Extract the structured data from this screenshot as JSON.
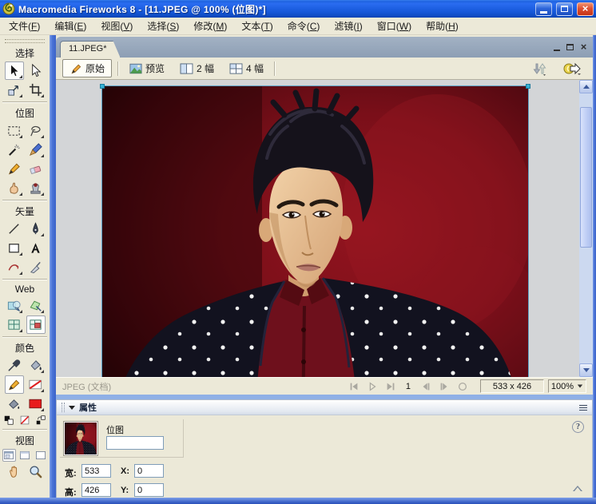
{
  "window": {
    "title": "Macromedia Fireworks 8 - [11.JPEG @ 100% (位图)*]"
  },
  "menu": {
    "items": [
      {
        "label": "文件",
        "letter": "F"
      },
      {
        "label": "编辑",
        "letter": "E"
      },
      {
        "label": "视图",
        "letter": "V"
      },
      {
        "label": "选择",
        "letter": "S"
      },
      {
        "label": "修改",
        "letter": "M"
      },
      {
        "label": "文本",
        "letter": "T"
      },
      {
        "label": "命令",
        "letter": "C"
      },
      {
        "label": "滤镜",
        "letter": "I"
      },
      {
        "label": "窗口",
        "letter": "W"
      },
      {
        "label": "帮助",
        "letter": "H"
      }
    ]
  },
  "document": {
    "tab_label": "11.JPEG*",
    "toolbar": {
      "original_label": "原始",
      "preview_label": "预览",
      "two_up_label": "2 幅",
      "four_up_label": "4 幅"
    },
    "status": {
      "doc_type": "JPEG (文档)",
      "frame_number": "1",
      "canvas_size": "533 x 426",
      "zoom_level": "100%"
    }
  },
  "tools": {
    "sections": [
      {
        "label": "选择",
        "rows": [
          [
            {
              "icon": "pointer",
              "name": "pointer-tool",
              "selected": true,
              "arrow": true
            },
            {
              "icon": "subselect",
              "name": "subselection-tool"
            }
          ],
          [
            {
              "icon": "scale",
              "name": "scale-tool",
              "arrow": true
            },
            {
              "icon": "crop",
              "name": "crop-tool",
              "arrow": true
            }
          ]
        ]
      },
      {
        "label": "位图",
        "rows": [
          [
            {
              "icon": "marquee",
              "name": "marquee-tool",
              "arrow": true
            },
            {
              "icon": "lasso",
              "name": "lasso-tool",
              "arrow": true
            }
          ],
          [
            {
              "icon": "wand",
              "name": "magic-wand-tool"
            },
            {
              "icon": "brush",
              "name": "brush-tool",
              "arrow": true
            }
          ],
          [
            {
              "icon": "pencil",
              "name": "pencil-tool"
            },
            {
              "icon": "eraser",
              "name": "eraser-tool"
            }
          ],
          [
            {
              "icon": "smudge",
              "name": "blur-tool",
              "arrow": true
            },
            {
              "icon": "stamp",
              "name": "rubber-stamp-tool",
              "arrow": true
            }
          ]
        ]
      },
      {
        "label": "矢量",
        "rows": [
          [
            {
              "icon": "line",
              "name": "line-tool"
            },
            {
              "icon": "pen",
              "name": "pen-tool",
              "arrow": true
            }
          ],
          [
            {
              "icon": "rect",
              "name": "rectangle-tool",
              "arrow": true
            },
            {
              "icon": "text",
              "name": "text-tool"
            }
          ],
          [
            {
              "icon": "freeform",
              "name": "freeform-tool",
              "arrow": true
            },
            {
              "icon": "knife",
              "name": "knife-tool"
            }
          ]
        ]
      },
      {
        "label": "Web",
        "rows": [
          [
            {
              "icon": "hotspot",
              "name": "hotspot-tool",
              "arrow": true
            },
            {
              "icon": "polyhotspot",
              "name": "polygon-hotspot-tool",
              "arrow": true
            }
          ],
          [
            {
              "icon": "slice",
              "name": "slice-tool",
              "arrow": true
            },
            {
              "icon": "sliceshow",
              "name": "show-slices-button",
              "selected": true
            }
          ]
        ]
      },
      {
        "label": "颜色",
        "rows": [
          [
            {
              "icon": "eyedropper",
              "name": "eyedropper-tool"
            },
            {
              "icon": "bucket",
              "name": "paint-bucket-tool",
              "arrow": true
            }
          ],
          [
            {
              "icon": "strokepencil",
              "name": "stroke-color-button",
              "selected": true
            },
            {
              "icon": "swatchnone",
              "name": "stroke-color-swatch",
              "arrow": true
            }
          ],
          [
            {
              "icon": "fillbucket",
              "name": "fill-color-button"
            },
            {
              "icon": "swatchred",
              "name": "fill-color-swatch",
              "arrow": true
            }
          ],
          [
            {
              "icon": "defaultcolors",
              "name": "default-colors-button",
              "small": true
            },
            {
              "icon": "nocolor",
              "name": "no-color-button",
              "small": true
            },
            {
              "icon": "swapcolors",
              "name": "swap-colors-button",
              "small": true
            }
          ]
        ]
      },
      {
        "label": "视图",
        "rows": [
          [
            {
              "icon": "screen1",
              "name": "standard-screen-button",
              "small": true,
              "selected": true
            },
            {
              "icon": "screen2",
              "name": "fullscreen-menus-button",
              "small": true
            },
            {
              "icon": "screen3",
              "name": "fullscreen-button",
              "small": true
            }
          ],
          [
            {
              "icon": "hand",
              "name": "hand-tool"
            },
            {
              "icon": "zoom",
              "name": "zoom-tool"
            }
          ]
        ]
      }
    ]
  },
  "properties": {
    "panel_title": "属性",
    "object_label": "位图",
    "object_name": "",
    "width_label": "宽:",
    "width_value": "533",
    "height_label": "高:",
    "height_value": "426",
    "x_label": "X:",
    "x_value": "0",
    "y_label": "Y:",
    "y_value": "0",
    "help_glyph": "?"
  },
  "colors": {
    "fill_color": "#e81c1c",
    "titlebar_blue": "#1557d8",
    "selection_handle": "#35b1d6",
    "canvas_surround": "#d3d5d7"
  }
}
